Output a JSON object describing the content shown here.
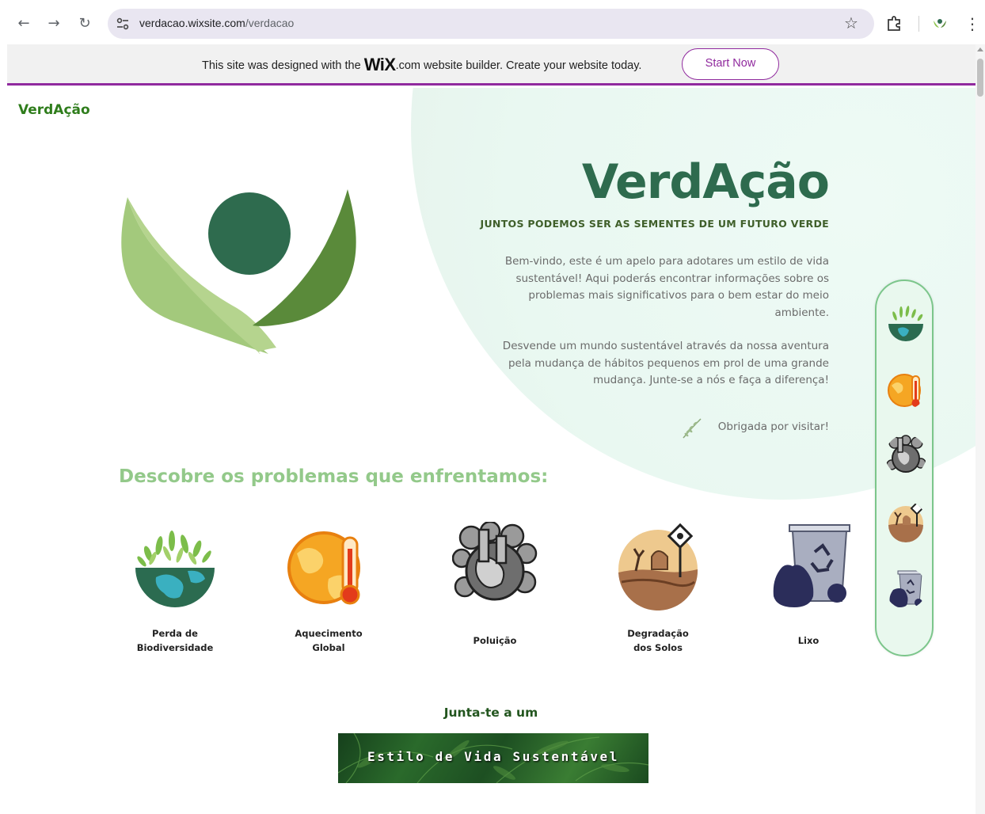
{
  "browser": {
    "url_host": "verdacao.wixsite.com",
    "url_path": "/verdacao",
    "back_icon": "arrow-left-icon",
    "forward_icon": "arrow-right-icon",
    "reload_icon": "reload-icon"
  },
  "wix_banner": {
    "message_before": "This site was designed with the",
    "logo_text": "WiX",
    "message_after": ".com website builder. Create your website today.",
    "cta_label": "Start Now",
    "accent": "#902a9e"
  },
  "site": {
    "brand": "VerdAção",
    "hero": {
      "title": "VerdAção",
      "subtitle": "JUNTOS PODEMOS SER AS SEMENTES DE UM FUTURO VERDE",
      "paragraph1": "Bem-vindo, este é um apelo para adotares um estilo de vida sustentável! Aqui poderás encontrar informações sobre os problemas mais significativos para o bem estar do meio ambiente.",
      "paragraph2": "Desvende um mundo sustentável através da nossa aventura pela mudança de hábitos pequenos em prol de uma grande mudança. Junte-se a nós e faça a diferença!",
      "thanks": "Obrigada por visitar!"
    },
    "problems_title": "Descobre os problemas que enfrentamos:",
    "problems": [
      {
        "label_line1": "Perda de",
        "label_line2": "Biodiversidade",
        "icon": "biodiversity-icon"
      },
      {
        "label_line1": "Aquecimento",
        "label_line2": "Global",
        "icon": "global-warming-icon"
      },
      {
        "label_line1": "Poluição",
        "label_line2": "",
        "icon": "pollution-icon"
      },
      {
        "label_line1": "Degradação",
        "label_line2": "dos Solos",
        "icon": "soil-degradation-icon"
      },
      {
        "label_line1": "Lixo",
        "label_line2": "",
        "icon": "trash-icon"
      }
    ],
    "join_text": "Junta-te a um",
    "banner_label": "Estilo de Vida Sustentável",
    "colors": {
      "brand_green": "#2f7d1c",
      "title_green": "#2e6b4e",
      "section_green": "#93c98a"
    }
  }
}
